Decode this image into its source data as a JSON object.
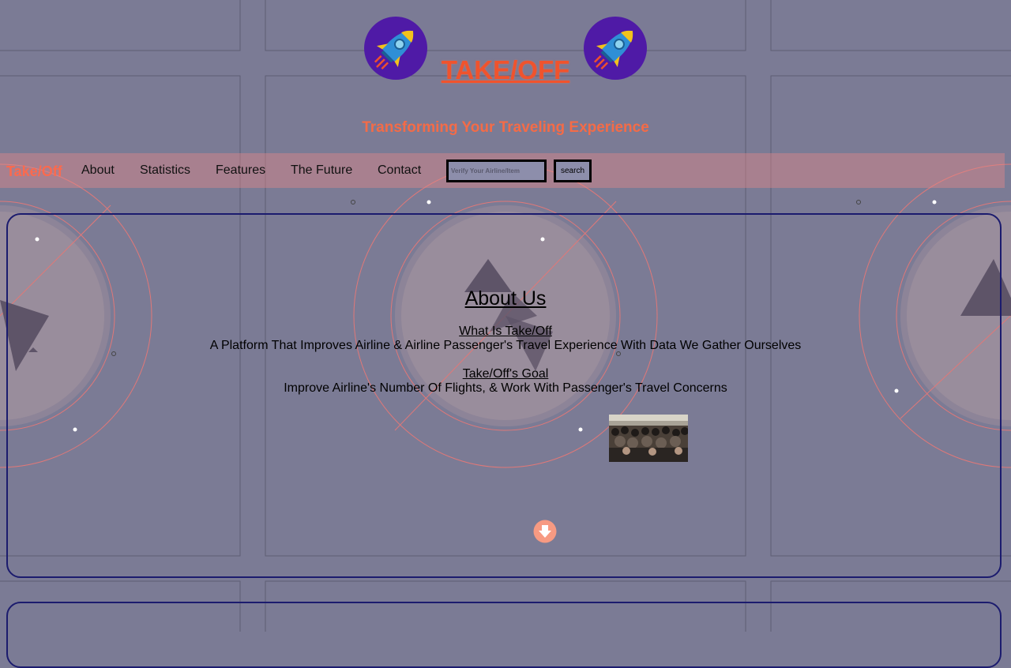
{
  "header": {
    "brand_title": "TAKE/OFF",
    "tagline": "Transforming Your Traveling Experience"
  },
  "navbar": {
    "brand": "Take/Off",
    "links": [
      "About",
      "Statistics",
      "Features",
      "The Future",
      "Contact"
    ],
    "search_placeholder": "Verify Your Airline/Item",
    "search_button": "search"
  },
  "about": {
    "title": "About Us ",
    "blocks": [
      {
        "heading": "What Is Take/Off",
        "text": "A Platform That Improves Airline & Airline Passenger's Travel Experience With Data We Gather Ourselves"
      },
      {
        "heading": "Take/Off's Goal",
        "text": "Improve Airline's Number Of Flights, & Work With Passenger's Travel Concerns"
      }
    ]
  },
  "icons": {
    "logo": "rocket-icon",
    "scroll": "arrow-down-circle-icon"
  },
  "colors": {
    "background": "#7b7b95",
    "brand": "#f0532d",
    "accent": "#fb6a4e",
    "border": "#1b1b6e"
  }
}
